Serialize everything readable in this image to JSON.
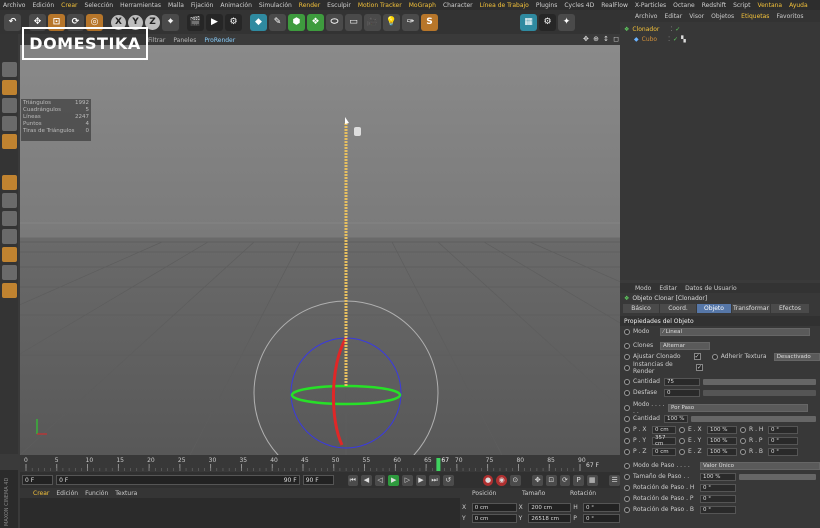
{
  "menubar": [
    "Archivo",
    "Edición",
    "Crear",
    "Selección",
    "Herramientas",
    "Malla",
    "Fijación",
    "Animación",
    "Simulación",
    "Render",
    "Esculpir",
    "Motion Tracker",
    "MoGraph",
    "Character",
    "Línea de Trabajo",
    "Plugins",
    "Cycles 4D",
    "RealFlow",
    "X-Particles",
    "Octane",
    "Redshift",
    "Script",
    "Ventana",
    "Ayuda"
  ],
  "menubar_highlight": [
    "Crear",
    "Render",
    "Motion Tracker",
    "MoGraph",
    "Línea de Trabajo",
    "Ventana",
    "Ayuda"
  ],
  "logo": "DOMESTIKA",
  "viewport_menu": [
    "Filtrar",
    "Paneles",
    "ProRender"
  ],
  "nav_icons": "✥ ⊕ ↕ ◻",
  "toolbar": {
    "axis_x": "X",
    "axis_y": "Y",
    "axis_z": "Z",
    "script_s": "S"
  },
  "stats": [
    {
      "label": "Triángulos",
      "value": "1992"
    },
    {
      "label": "Cuadrángulos",
      "value": "5"
    },
    {
      "label": "Líneas",
      "value": "2247"
    },
    {
      "label": "Puntos",
      "value": "4"
    },
    {
      "label": "Tiras de Triángulos",
      "value": "0"
    }
  ],
  "timeline": {
    "ticks": [
      "0",
      "5",
      "10",
      "15",
      "20",
      "25",
      "30",
      "35",
      "40",
      "45",
      "50",
      "55",
      "60",
      "65",
      "70",
      "75",
      "80",
      "85",
      "90"
    ],
    "current_frame": "67",
    "end_label": "67 F",
    "playhead_frac": 0.7444
  },
  "playbar": {
    "start": "0 F",
    "start2": "0 F",
    "end2": "90 F",
    "end": "90 F"
  },
  "bottom_menu": [
    "Crear",
    "Edición",
    "Función",
    "Textura"
  ],
  "coords": {
    "headers": [
      "Posición",
      "Tamaño",
      "Rotación"
    ],
    "rows": [
      {
        "axis": "X",
        "pos": "0 cm",
        "size": "200 cm",
        "rlabel": "H",
        "rot": "0 °"
      },
      {
        "axis": "Y",
        "pos": "0 cm",
        "size": "26518 cm",
        "rlabel": "P",
        "rot": "0 °"
      }
    ]
  },
  "object_manager": {
    "menu": [
      "Archivo",
      "Editar",
      "Visor",
      "Objetos",
      "Etiquetas",
      "Favoritos"
    ],
    "items": [
      {
        "name": "Clonador",
        "color": "#f4c23a"
      },
      {
        "name": "Cubo",
        "color": "#d08f3a"
      }
    ]
  },
  "attributes": {
    "menu": [
      "Modo",
      "Editar",
      "Datos de Usuario"
    ],
    "title": "Objeto Clonar [Clonador]",
    "tabs": [
      {
        "label": "Básico",
        "active": false
      },
      {
        "label": "Coord.",
        "active": false
      },
      {
        "label": "Objeto",
        "active": true
      },
      {
        "label": "Transformar",
        "active": false
      },
      {
        "label": "Efectos",
        "active": false
      }
    ],
    "section": "Propiedades del Objeto",
    "modo_label": "Modo",
    "modo_value": "Lineal",
    "clones_label": "Clones",
    "clones_value": "Alternar",
    "ajustar_label": "Ajustar Clonado",
    "adherir_label": "Adherir Textura",
    "adherir_value": "Desactivado",
    "instancias_label": "Instancias de Render",
    "cantidad_label": "Cantidad",
    "cantidad_value": "75",
    "desfase_label": "Desfase",
    "desfase_value": "0",
    "modo2_label": "Modo . . . . . .",
    "modo2_value": "Por Paso",
    "cant2_label": "Cantidad",
    "cant2_value": "100 %",
    "p_rows": [
      {
        "p": "P . X",
        "pv": "0 cm",
        "e": "E . X",
        "ev": "100 %",
        "r": "R . H",
        "rv": "0 °"
      },
      {
        "p": "P . Y",
        "pv": "357 cm",
        "e": "E . Y",
        "ev": "100 %",
        "r": "R . P",
        "rv": "0 °"
      },
      {
        "p": "P . Z",
        "pv": "0 cm",
        "e": "E . Z",
        "ev": "100 %",
        "r": "R . B",
        "rv": "0 °"
      }
    ],
    "paso_label": "Modo de Paso . . . .",
    "paso_value": "Valor Único",
    "tam_label": "Tamaño de Paso . .",
    "tam_value": "100 %",
    "rot_rows": [
      {
        "label": "Rotación de Paso . H",
        "value": "0 °"
      },
      {
        "label": "Rotación de Paso . P",
        "value": "0 °"
      },
      {
        "label": "Rotación de Paso . B",
        "value": "0 °"
      }
    ]
  },
  "side_label": "MAXON CINEMA 4D"
}
